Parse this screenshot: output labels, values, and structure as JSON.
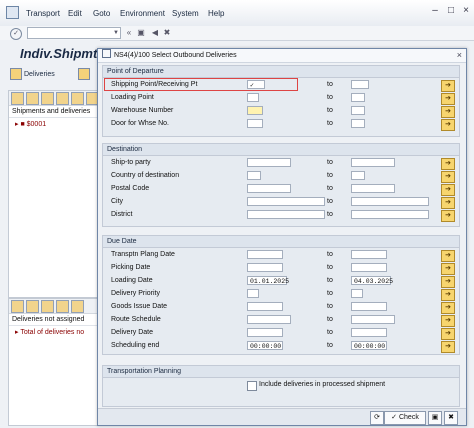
{
  "menu": {
    "items": [
      "Transport",
      "Edit",
      "Goto",
      "Environment",
      "System",
      "Help"
    ]
  },
  "toolbar": {
    "command_value": ""
  },
  "app": {
    "title": "Indiv.Shipmt",
    "deliveries_btn": "Deliveries",
    "tree_header": "Shipments and deliveries",
    "tree_item": "$0001",
    "bottom_header": "Deliveries not assigned",
    "bottom_item": "Total of deliveries no"
  },
  "dialog": {
    "title": "NS4(4)/100 Select Outbound Deliveries",
    "to_label": "to",
    "groups": {
      "departure": {
        "title": "Point of Departure",
        "rows": [
          {
            "label": "Shipping Point/Receiving Pt",
            "from": "",
            "to": ""
          },
          {
            "label": "Loading Point",
            "from": "",
            "to": ""
          },
          {
            "label": "Warehouse Number",
            "from": "",
            "to": ""
          },
          {
            "label": "Door for Whse No.",
            "from": "",
            "to": ""
          }
        ]
      },
      "destination": {
        "title": "Destination",
        "rows": [
          {
            "label": "Ship-to party",
            "from": "",
            "to": ""
          },
          {
            "label": "Country of destination",
            "from": "",
            "to": ""
          },
          {
            "label": "Postal Code",
            "from": "",
            "to": ""
          },
          {
            "label": "City",
            "from": "",
            "to": ""
          },
          {
            "label": "District",
            "from": "",
            "to": ""
          }
        ]
      },
      "duedate": {
        "title": "Due Date",
        "rows": [
          {
            "label": "Transptn Plang Date",
            "from": "",
            "to": ""
          },
          {
            "label": "Picking Date",
            "from": "",
            "to": ""
          },
          {
            "label": "Loading Date",
            "from": "01.01.2025",
            "to": "04.03.2025"
          },
          {
            "label": "Delivery Priority",
            "from": "",
            "to": ""
          },
          {
            "label": "Goods Issue Date",
            "from": "",
            "to": ""
          },
          {
            "label": "Route Schedule",
            "from": "",
            "to": ""
          },
          {
            "label": "Delivery Date",
            "from": "",
            "to": ""
          },
          {
            "label": "Scheduling end",
            "from": "00:00:00",
            "to": "00:00:00"
          }
        ]
      },
      "transport": {
        "title": "Transportation Planning",
        "checkbox_label": "Include deliveries in processed shipment"
      }
    },
    "footer": {
      "check_label": "Check"
    }
  }
}
